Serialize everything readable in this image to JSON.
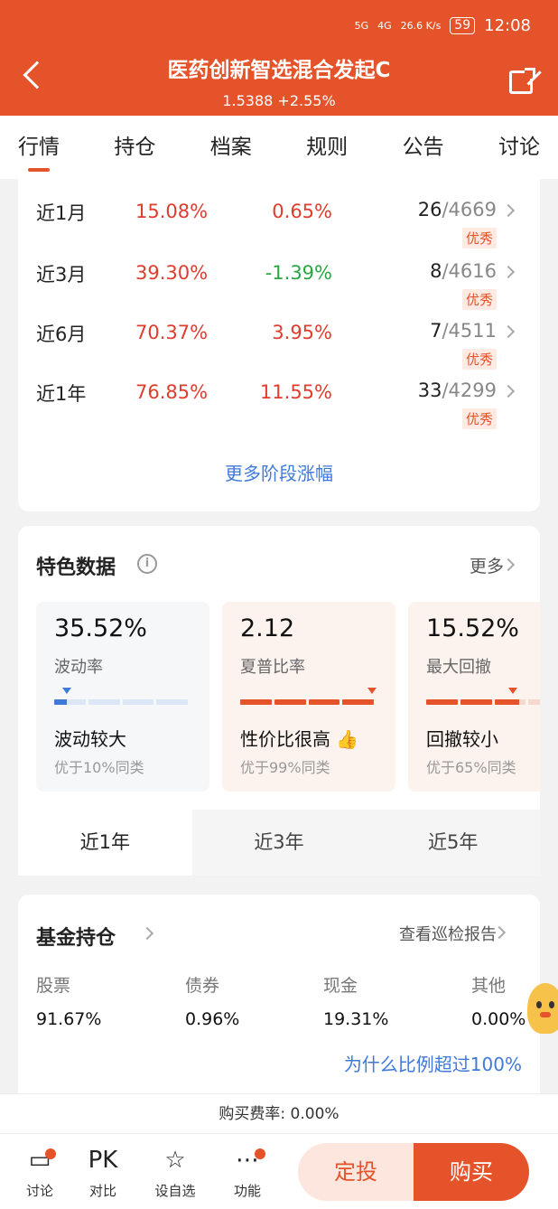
{
  "status": {
    "signal1": "5G",
    "signal2": "4G",
    "speed": "26.6 K/s",
    "battery": "59",
    "time": "12:08"
  },
  "header": {
    "title": "医药创新智选混合发起C",
    "nav": "1.5388 +2.55%"
  },
  "tabs": [
    "行情",
    "持仓",
    "档案",
    "规则",
    "公告",
    "讨论"
  ],
  "performance": {
    "rows": [
      {
        "period": "近1月",
        "return": "15.08%",
        "vs": "0.65%",
        "vs_color": "red",
        "rank": "26",
        "total": "/4669",
        "badge": "优秀"
      },
      {
        "period": "近3月",
        "return": "39.30%",
        "vs": "-1.39%",
        "vs_color": "green",
        "rank": "8",
        "total": "/4616",
        "badge": "优秀"
      },
      {
        "period": "近6月",
        "return": "70.37%",
        "vs": "3.95%",
        "vs_color": "red",
        "rank": "7",
        "total": "/4511",
        "badge": "优秀"
      },
      {
        "period": "近1年",
        "return": "76.85%",
        "vs": "11.55%",
        "vs_color": "red",
        "rank": "33",
        "total": "/4299",
        "badge": "优秀"
      }
    ],
    "more": "更多阶段涨幅"
  },
  "feature": {
    "title": "特色数据",
    "more": "更多",
    "cards": [
      {
        "value": "35.52%",
        "label": "波动率",
        "desc": "波动较大",
        "sub": "优于10%同类",
        "level": 0.05
      },
      {
        "value": "2.12",
        "label": "夏普比率",
        "desc": "性价比很高",
        "sub": "优于99%同类",
        "level": 0.99
      },
      {
        "value": "15.52%",
        "label": "最大回撤",
        "desc": "回撤较小",
        "sub": "优于65%同类",
        "level": 0.65
      }
    ],
    "periods": [
      "近1年",
      "近3年",
      "近5年"
    ]
  },
  "holdings": {
    "title": "基金持仓",
    "report": "查看巡检报告",
    "items": [
      {
        "k": "股票",
        "v": "91.67%"
      },
      {
        "k": "债券",
        "v": "0.96%"
      },
      {
        "k": "现金",
        "v": "19.31%"
      },
      {
        "k": "其他",
        "v": "0.00%"
      }
    ],
    "why": "为什么比例超过100%"
  },
  "fee": "购买费率: 0.00%",
  "bottom": {
    "items": [
      {
        "icon": "comment-icon",
        "label": "讨论"
      },
      {
        "icon": "pk-icon",
        "label": "对比",
        "glyph": "PK"
      },
      {
        "icon": "star-plus-icon",
        "label": "设自选"
      },
      {
        "icon": "more-icon",
        "label": "功能"
      }
    ],
    "dingtou": "定投",
    "buy": "购买"
  },
  "colors": {
    "brand": "#e5532b",
    "up": "#e03c2e",
    "down": "#2aa642",
    "link": "#3f7ad9"
  }
}
